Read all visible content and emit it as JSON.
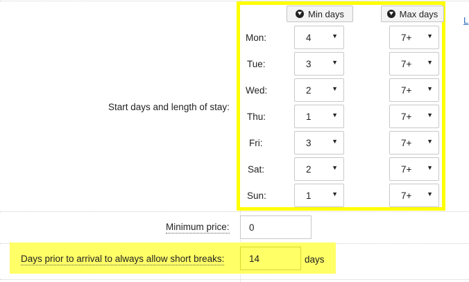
{
  "form": {
    "start_days_label": "Start days and length of stay:",
    "min_days_button": "Min days",
    "max_days_button": "Max days",
    "days": [
      {
        "label": "Mon:",
        "min": "4",
        "max": "7+"
      },
      {
        "label": "Tue:",
        "min": "3",
        "max": "7+"
      },
      {
        "label": "Wed:",
        "min": "2",
        "max": "7+"
      },
      {
        "label": "Thu:",
        "min": "1",
        "max": "7+"
      },
      {
        "label": "Fri:",
        "min": "3",
        "max": "7+"
      },
      {
        "label": "Sat:",
        "min": "2",
        "max": "7+"
      },
      {
        "label": "Sun:",
        "min": "1",
        "max": "7+"
      }
    ],
    "minimum_price_label": "Minimum price:",
    "minimum_price_value": "0",
    "short_breaks_label": "Days prior to arrival to always allow short breaks:",
    "short_breaks_value": "14",
    "short_breaks_unit": "days",
    "edge_link": "L"
  },
  "colors": {
    "highlight_border": "#ffff00",
    "highlight_fill": "#ffff66",
    "link": "#2a6ebb"
  },
  "icons": {
    "header_button_icon": "circle-arrow-down-icon",
    "select_arrow": "caret-down-icon"
  }
}
